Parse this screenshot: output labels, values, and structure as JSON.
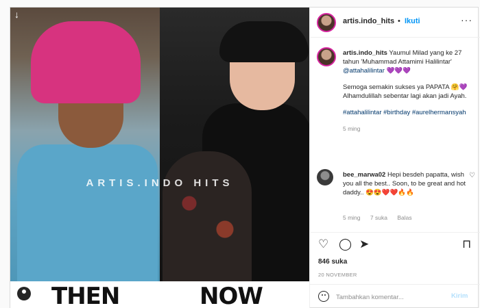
{
  "photo": {
    "watermark": "ARTIS.INDO HITS",
    "then_label": "THEN",
    "now_label": "NOW",
    "download_icon": "↓"
  },
  "header": {
    "username": "artis.indo_hits",
    "dot": "•",
    "follow_label": "Ikuti",
    "more_icon": "···"
  },
  "post": {
    "username": "artis.indo_hits",
    "line1": "Yaumul Milad yang ke 27 tahun 'Muhammad Attamimi Halilintar'",
    "mention": "@attahalilintar",
    "hearts": "💜💜💜",
    "para2": "Semoga semakin sukses ya PAPATA 🤗💜 Alhamdulillah sebentar lagi akan jadi Ayah.",
    "hashtags": "#attahalilintar #birthday #aurelhermansyah",
    "time": "5 ming"
  },
  "reply": {
    "username": "bee_marwa02",
    "text": "Hepi besdeh papatta, wish you all the best.. Soon, to be great and hot daddy.. 😍😍❤️❤️🔥🔥",
    "time": "5 ming",
    "likes": "7 suka",
    "reply_label": "Balas",
    "heart_icon": "♡"
  },
  "actions": {
    "like_icon": "♡",
    "comment_icon": "◯",
    "share_icon": "➤",
    "save_icon": "⊓"
  },
  "likes": "846 suka",
  "date": "20 NOVEMBER",
  "comment_bar": {
    "placeholder": "Tambahkan komentar...",
    "post_label": "Kirim"
  },
  "colors": {
    "accent": "#0095f6",
    "link": "#00376b",
    "muted": "#8e8e8e",
    "post_disabled": "#b2dffc"
  }
}
